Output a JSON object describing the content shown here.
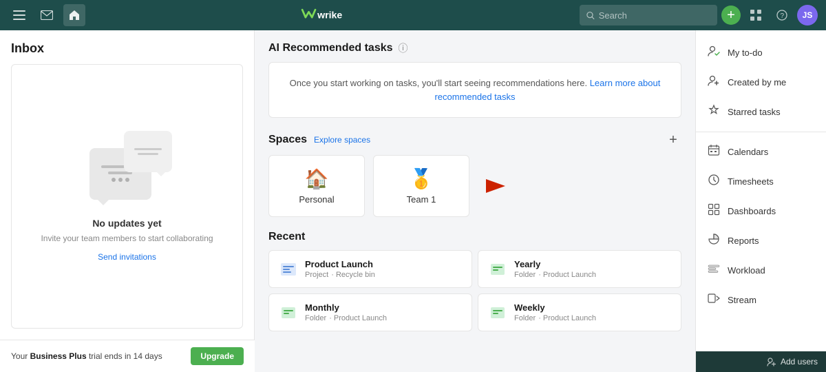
{
  "nav": {
    "logo_text": "wrike",
    "search_placeholder": "Search",
    "add_button_label": "+",
    "avatar_initials": "JS",
    "avatar_bg": "#7b68ee"
  },
  "inbox": {
    "title": "Inbox",
    "no_updates": "No updates yet",
    "no_updates_sub": "Invite your team members to start collaborating",
    "send_invitations_label": "Send invitations",
    "trial_text_prefix": "Your ",
    "trial_plan": "Business Plus",
    "trial_text_suffix": " trial ends in 14 days",
    "upgrade_label": "Upgrade"
  },
  "ai_section": {
    "title": "AI Recommended tasks",
    "info_icon": "?",
    "message": "Once you start working on tasks, you'll start seeing recommendations here.",
    "link_text": "Learn more about recommended tasks"
  },
  "spaces": {
    "title": "Spaces",
    "explore_label": "Explore spaces",
    "add_label": "+",
    "items": [
      {
        "name": "Personal",
        "icon": "🏠",
        "icon_color": "#4caf50"
      },
      {
        "name": "Team 1",
        "icon": "🥇",
        "icon_color": "#c8a000"
      }
    ]
  },
  "recent": {
    "title": "Recent",
    "items": [
      {
        "name": "Product Launch",
        "type": "Project",
        "parent": "Recycle bin",
        "icon_color": "#5b8dd9"
      },
      {
        "name": "Yearly",
        "type": "Folder",
        "parent": "Product Launch",
        "icon_color": "#4caf50"
      },
      {
        "name": "Monthly",
        "type": "Folder",
        "parent": "Product Launch",
        "icon_color": "#4caf50"
      },
      {
        "name": "Weekly",
        "type": "Folder",
        "parent": "Product Launch",
        "icon_color": "#4caf50"
      }
    ]
  },
  "right_sidebar": {
    "items": [
      {
        "id": "my-todo",
        "label": "My to-do",
        "icon": "person-check"
      },
      {
        "id": "created-by-me",
        "label": "Created by me",
        "icon": "person-plus"
      },
      {
        "id": "starred-tasks",
        "label": "Starred tasks",
        "icon": "star"
      },
      {
        "id": "calendars",
        "label": "Calendars",
        "icon": "calendar"
      },
      {
        "id": "timesheets",
        "label": "Timesheets",
        "icon": "clock"
      },
      {
        "id": "dashboards",
        "label": "Dashboards",
        "icon": "dashboard"
      },
      {
        "id": "reports",
        "label": "Reports",
        "icon": "pie-chart"
      },
      {
        "id": "workload",
        "label": "Workload",
        "icon": "workload"
      },
      {
        "id": "stream",
        "label": "Stream",
        "icon": "stream"
      }
    ],
    "add_users_label": "Add users"
  }
}
